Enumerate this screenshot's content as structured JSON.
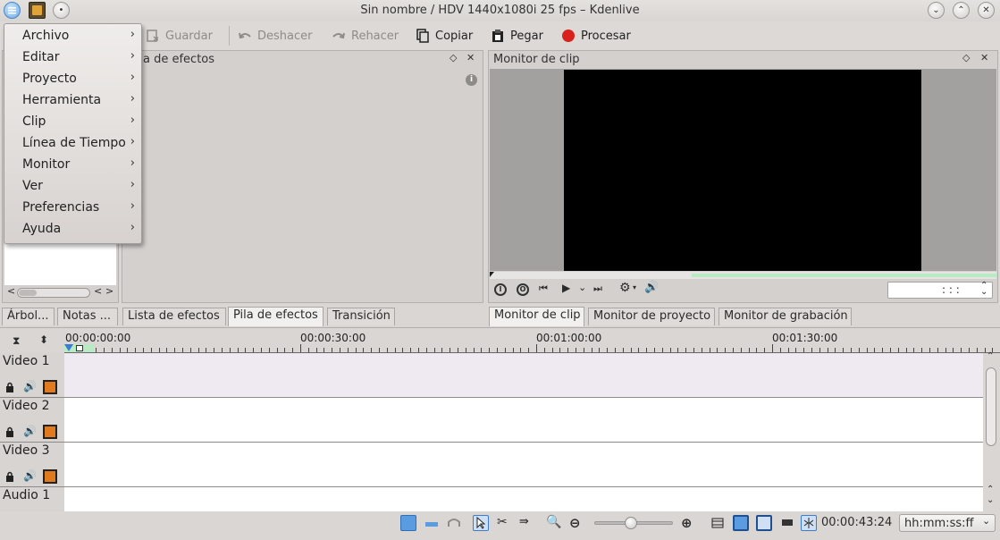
{
  "window": {
    "title": "Sin nombre / HDV 1440x1080i 25 fps – Kdenlive"
  },
  "toolbar": {
    "save": "Guardar",
    "undo": "Deshacer",
    "redo": "Rehacer",
    "copy": "Copiar",
    "paste": "Pegar",
    "render": "Procesar"
  },
  "menu": {
    "items": [
      {
        "label": "Archivo"
      },
      {
        "label": "Editar"
      },
      {
        "label": "Proyecto"
      },
      {
        "label": "Herramienta"
      },
      {
        "label": "Clip"
      },
      {
        "label": "Línea de Tiempo"
      },
      {
        "label": "Monitor"
      },
      {
        "label": "Ver"
      },
      {
        "label": "Preferencias"
      },
      {
        "label": "Ayuda"
      }
    ]
  },
  "effects_panel": {
    "title": "a de efectos"
  },
  "clip_monitor": {
    "title": "Monitor de clip",
    "timecode": ": : :"
  },
  "left_tabs": [
    {
      "label": "Árbol..."
    },
    {
      "label": "Notas ..."
    },
    {
      "label": "Lista de efectos"
    },
    {
      "label": "Pila de efectos"
    },
    {
      "label": "Transición"
    }
  ],
  "monitor_tabs": [
    {
      "label": "Monitor de clip"
    },
    {
      "label": "Monitor de proyecto"
    },
    {
      "label": "Monitor de grabación"
    }
  ],
  "ruler": {
    "labels": [
      "00:00:00:00",
      "00:00:30:00",
      "00:01:00:00",
      "00:01:30:00"
    ]
  },
  "tracks": [
    {
      "name": "Video 1"
    },
    {
      "name": "Video 2"
    },
    {
      "name": "Video 3"
    },
    {
      "name": "Audio 1"
    }
  ],
  "status": {
    "timecode": "00:00:43:24",
    "time_format": "hh:mm:ss:ff"
  },
  "colors": {
    "accent": "#3a7bd5",
    "record": "#d9221c",
    "track_selected": "#efe9f1"
  }
}
